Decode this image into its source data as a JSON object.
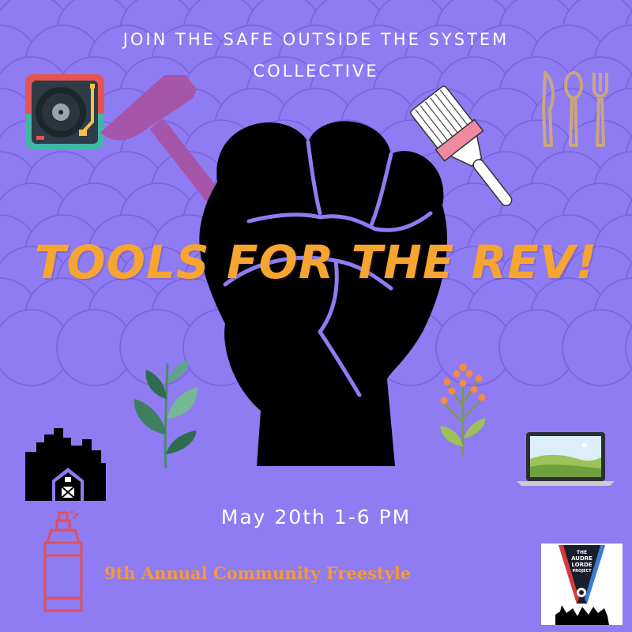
{
  "header": {
    "line1": "JOIN THE SAFE OUTSIDE THE SYSTEM",
    "line2": "COLLECTIVE"
  },
  "headline": "TOOLS FOR THE REV!",
  "event": {
    "date": "May 20th 1-6 PM",
    "subtitle": "9th Annual Community Freestyle"
  },
  "logo": {
    "line1": "THE",
    "line2": "AUDRE",
    "line3": "LORDE",
    "line4": "PROJECT"
  },
  "colors": {
    "background": "#8f7bf2",
    "headline": "#f6a531",
    "subtitle": "#f19a3e",
    "text": "#ffffff",
    "fist": "#000000"
  },
  "icons": [
    "turntable-icon",
    "hammer-icon",
    "paintbrush-icon",
    "utensils-icon",
    "raised-fist-icon",
    "leaf-plant-icon",
    "flower-plant-icon",
    "city-barn-icon",
    "laptop-icon",
    "spray-can-icon"
  ]
}
